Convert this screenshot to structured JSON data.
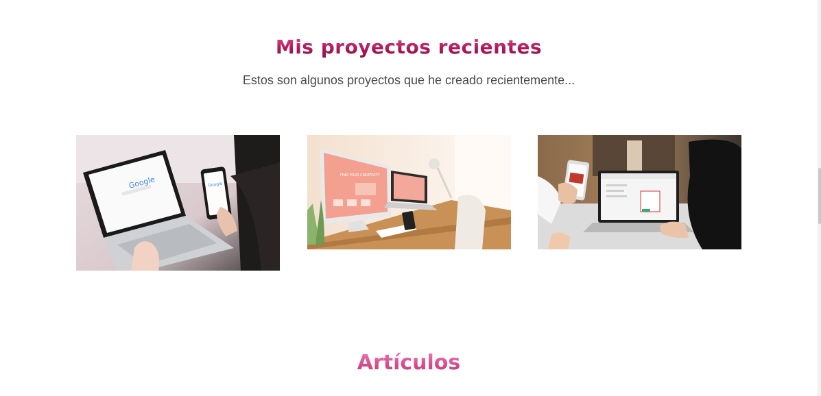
{
  "projects": {
    "title": "Mis proyectos recientes",
    "subtitle": "Estos son algunos proyectos que he creado recientemente...",
    "items": [
      {
        "name": "laptop-google-search",
        "screen_text": "Google"
      },
      {
        "name": "responsive-web-design",
        "screen_text": "FIND YOUR CREATIVITY"
      },
      {
        "name": "online-form-app",
        "screen_text": ""
      }
    ]
  },
  "articles": {
    "title": "Artículos"
  },
  "colors": {
    "title_pink": "#c2185b",
    "articles_pink": "#e0609e",
    "subtitle_gray": "#4a4a4a"
  }
}
